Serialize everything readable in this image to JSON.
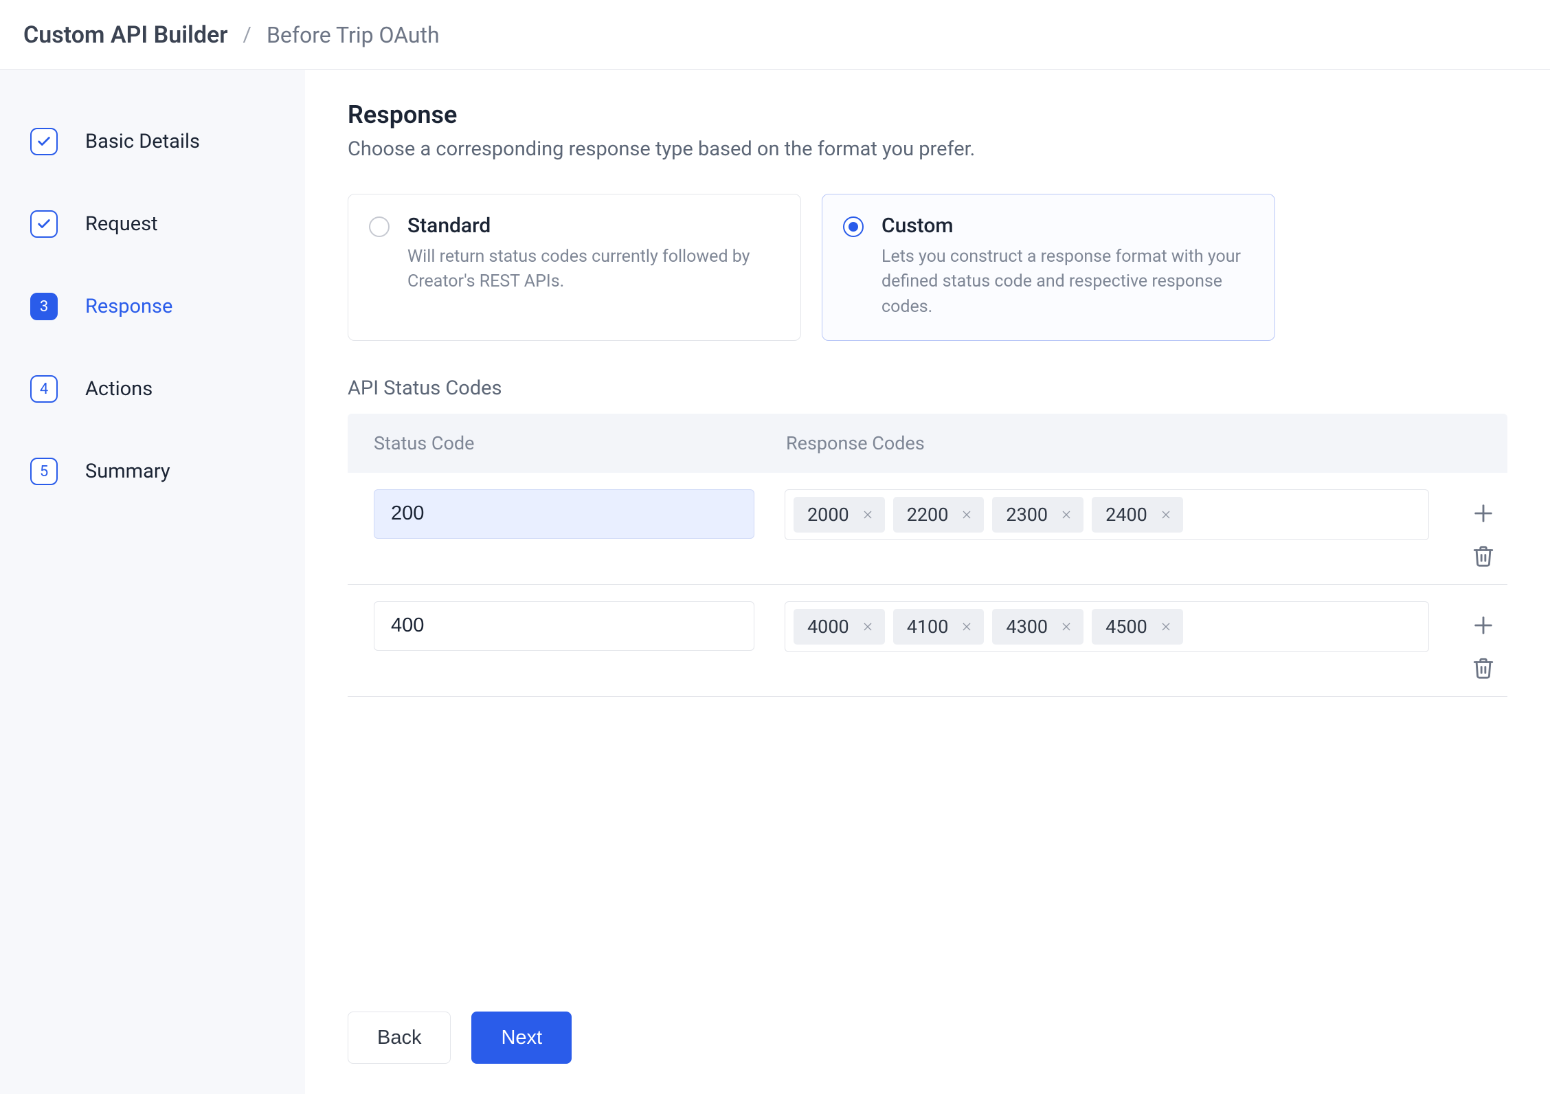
{
  "breadcrumb": {
    "root": "Custom API Builder",
    "separator": "/",
    "leaf": "Before Trip OAuth"
  },
  "steps": [
    {
      "label": "Basic Details",
      "state": "done"
    },
    {
      "label": "Request",
      "state": "done"
    },
    {
      "label": "Response",
      "state": "active",
      "num": "3"
    },
    {
      "label": "Actions",
      "state": "todo",
      "num": "4"
    },
    {
      "label": "Summary",
      "state": "todo",
      "num": "5"
    }
  ],
  "page": {
    "title": "Response",
    "subtitle": "Choose a corresponding response type based on the format you prefer."
  },
  "response_type": {
    "standard": {
      "title": "Standard",
      "desc": "Will return status codes currently followed by Creator's REST APIs.",
      "selected": false
    },
    "custom": {
      "title": "Custom",
      "desc": "Lets you construct a response format with your defined status code and respective response codes.",
      "selected": true
    }
  },
  "status_codes": {
    "section_label": "API Status Codes",
    "columns": {
      "status": "Status Code",
      "resp": "Response Codes"
    },
    "rows": [
      {
        "status": "200",
        "highlight": true,
        "codes": [
          "2000",
          "2200",
          "2300",
          "2400"
        ]
      },
      {
        "status": "400",
        "highlight": false,
        "codes": [
          "4000",
          "4100",
          "4300",
          "4500"
        ]
      }
    ]
  },
  "footer": {
    "back": "Back",
    "next": "Next"
  }
}
